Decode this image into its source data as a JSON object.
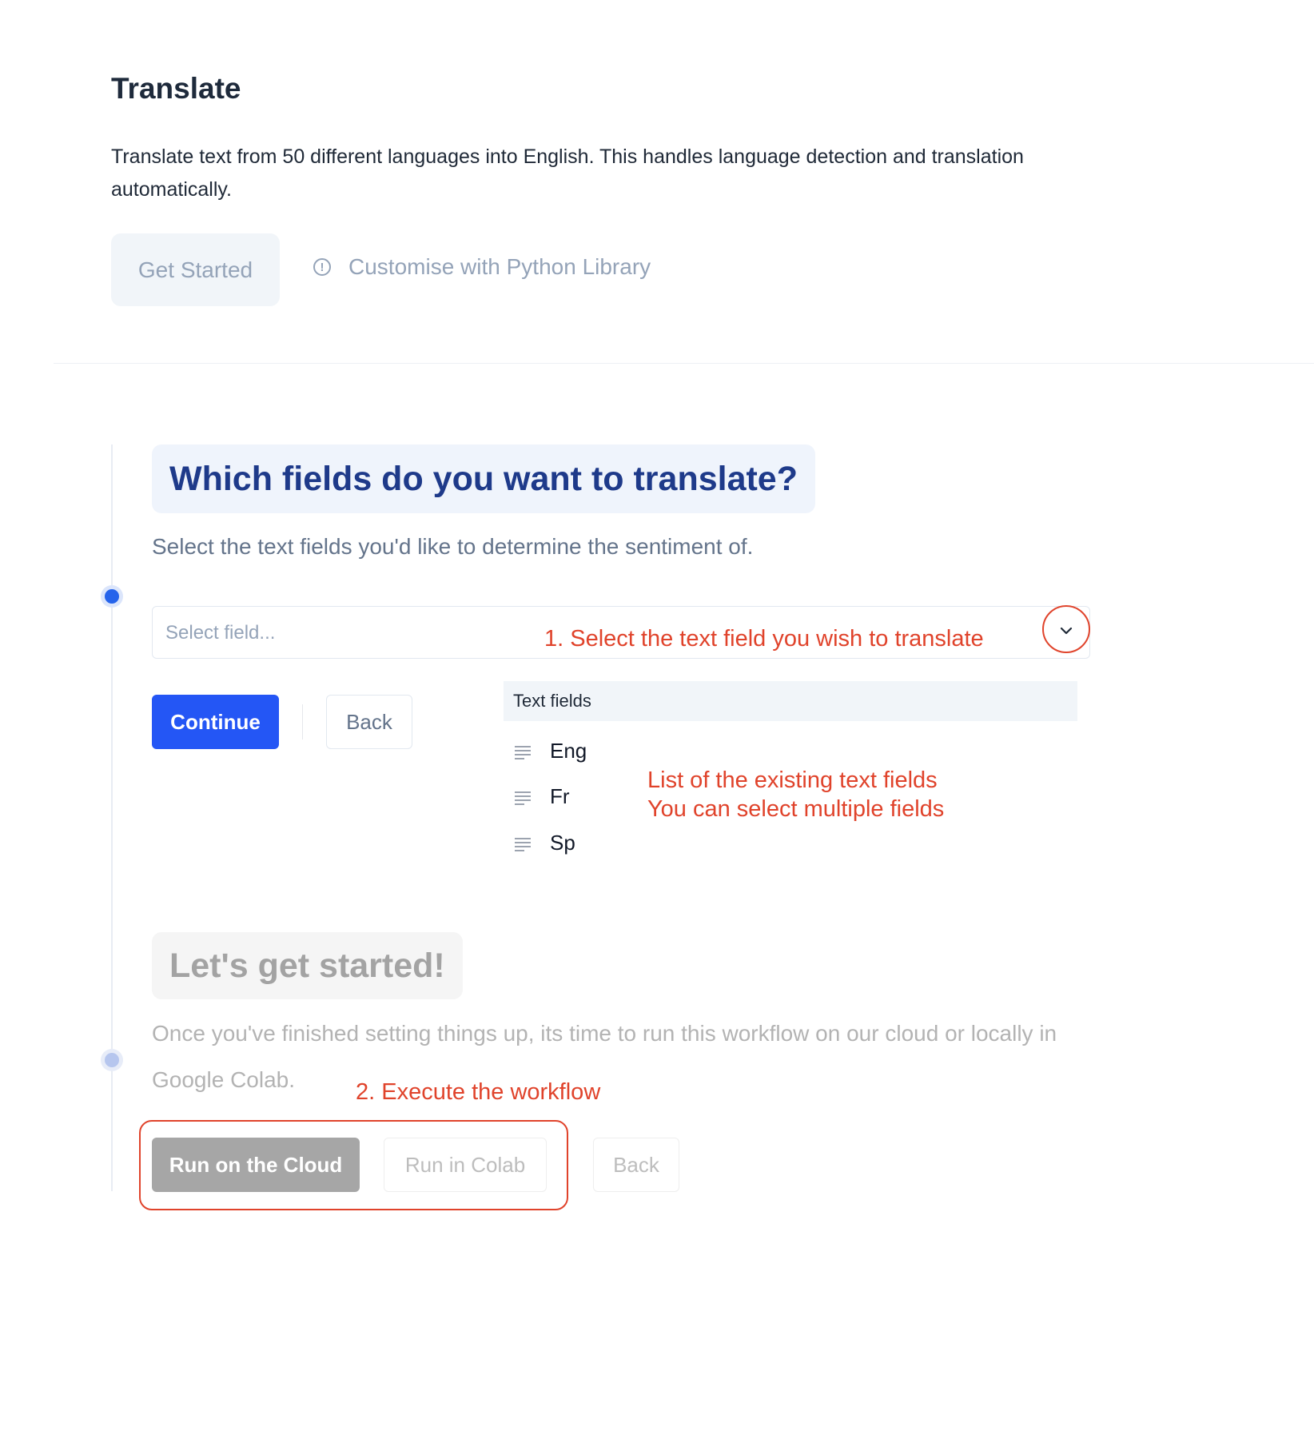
{
  "header": {
    "title": "Translate",
    "description": "Translate text from 50 different languages into English. This handles language detection and translation automatically.",
    "get_started_label": "Get Started",
    "customise_label": "Customise with Python Library",
    "customise_icon": "info-icon"
  },
  "step1": {
    "title": "Which fields do you want to translate?",
    "description": "Select the text fields you'd like to determine the sentiment of.",
    "select_placeholder": "Select field...",
    "select_icon": "chevron-down-icon",
    "continue_label": "Continue",
    "back_label": "Back",
    "dropdown": {
      "header": "Text fields",
      "item_icon": "text-lines-icon",
      "items": [
        {
          "label": "Eng"
        },
        {
          "label": "Fr"
        },
        {
          "label": "Sp"
        }
      ]
    }
  },
  "step2": {
    "title": "Let's get started!",
    "description": "Once you've finished setting things up, its time to run this workflow on our cloud or locally in Google Colab.",
    "run_cloud_label": "Run on the Cloud",
    "run_colab_label": "Run in Colab",
    "back_label": "Back"
  },
  "annotations": {
    "select_hint": "1. Select the text field you wish to translate",
    "list_hint_line1": "List of the existing text fields",
    "list_hint_line2": "You can select multiple fields",
    "execute_hint": "2. Execute the workflow",
    "color": "#e0432b"
  },
  "colors": {
    "primary": "#2456f5",
    "heading_active": "#1e3a8a",
    "heading_inactive": "#a3a3a3",
    "muted_text": "#94a3b8"
  }
}
